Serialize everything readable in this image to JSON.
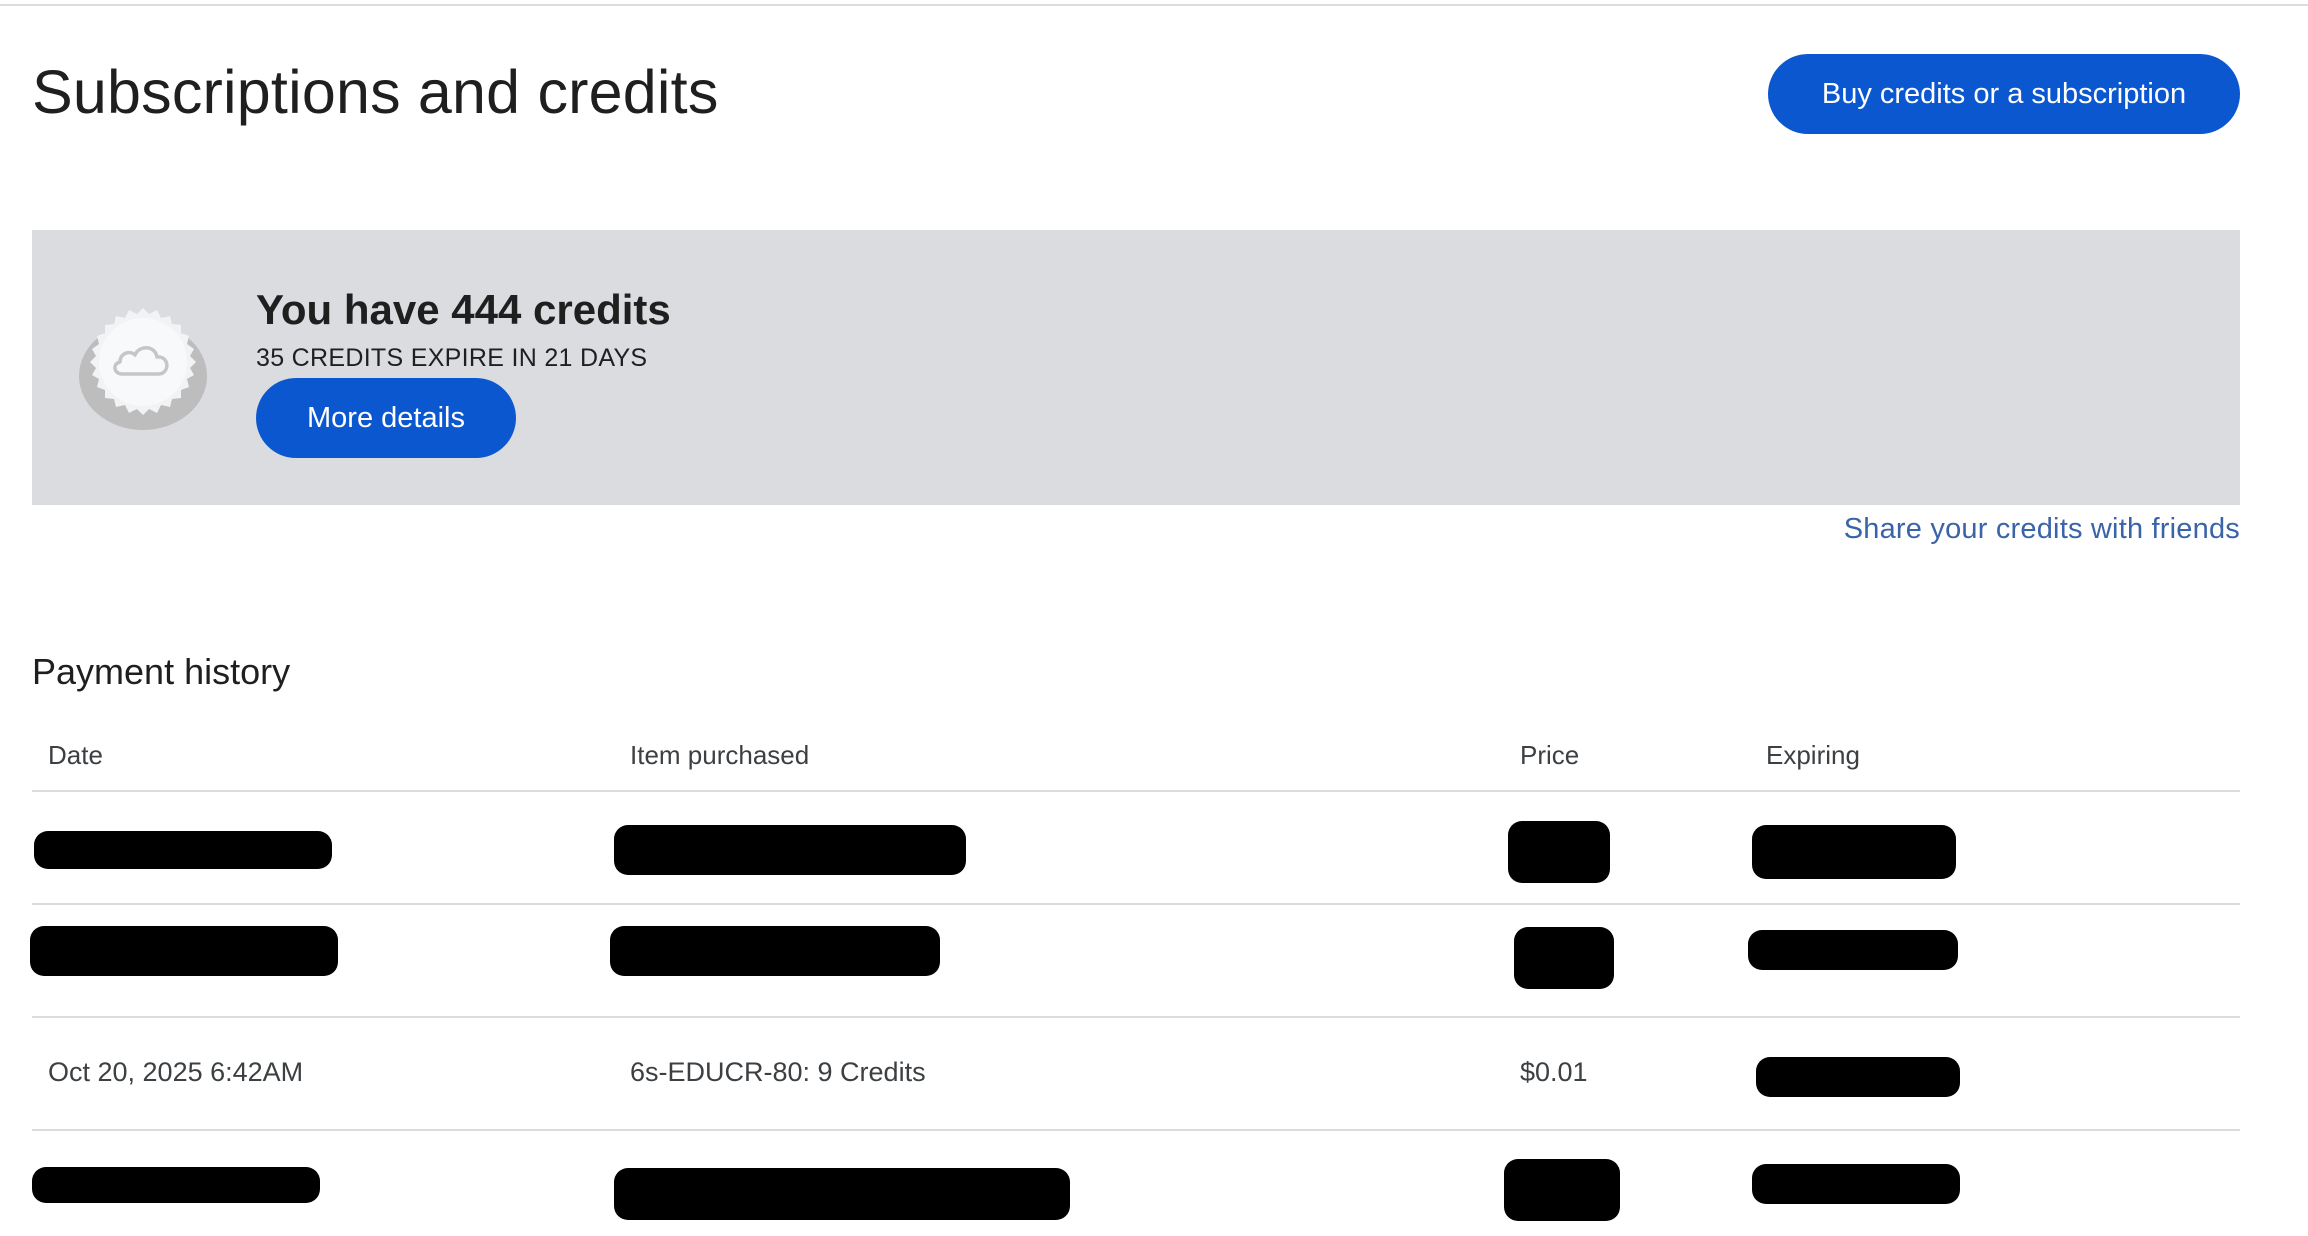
{
  "header": {
    "title": "Subscriptions and credits",
    "buy_button_label": "Buy credits or a subscription"
  },
  "credits": {
    "headline": "You have 444 credits",
    "expiry_notice": "35 CREDITS EXPIRE IN 21 DAYS",
    "details_button_label": "More details",
    "coin_icon": "cloud-coin-icon"
  },
  "share_link_label": "Share your credits with friends",
  "payment_history": {
    "title": "Payment history",
    "columns": [
      "Date",
      "Item purchased",
      "Price",
      "Expiring"
    ],
    "rows": [
      {
        "date": "",
        "item": "",
        "price": "",
        "expiring": "",
        "redacted": [
          "date",
          "item",
          "price",
          "expiring"
        ]
      },
      {
        "date": "",
        "item": "",
        "price": "",
        "expiring": "",
        "redacted": [
          "date",
          "item",
          "price",
          "expiring"
        ]
      },
      {
        "date": "Oct 20, 2025 6:42AM",
        "item": "6s-EDUCR-80: 9 Credits",
        "price": "$0.01",
        "expiring": "",
        "redacted": [
          "expiring"
        ]
      },
      {
        "date": "",
        "item": "",
        "price": "",
        "expiring": "",
        "redacted": [
          "date",
          "item",
          "price",
          "expiring"
        ]
      }
    ]
  },
  "colors": {
    "accent": "#0b57d0",
    "card_background": "#dadce0",
    "link": "#3a64a8",
    "divider": "#dadce0"
  }
}
